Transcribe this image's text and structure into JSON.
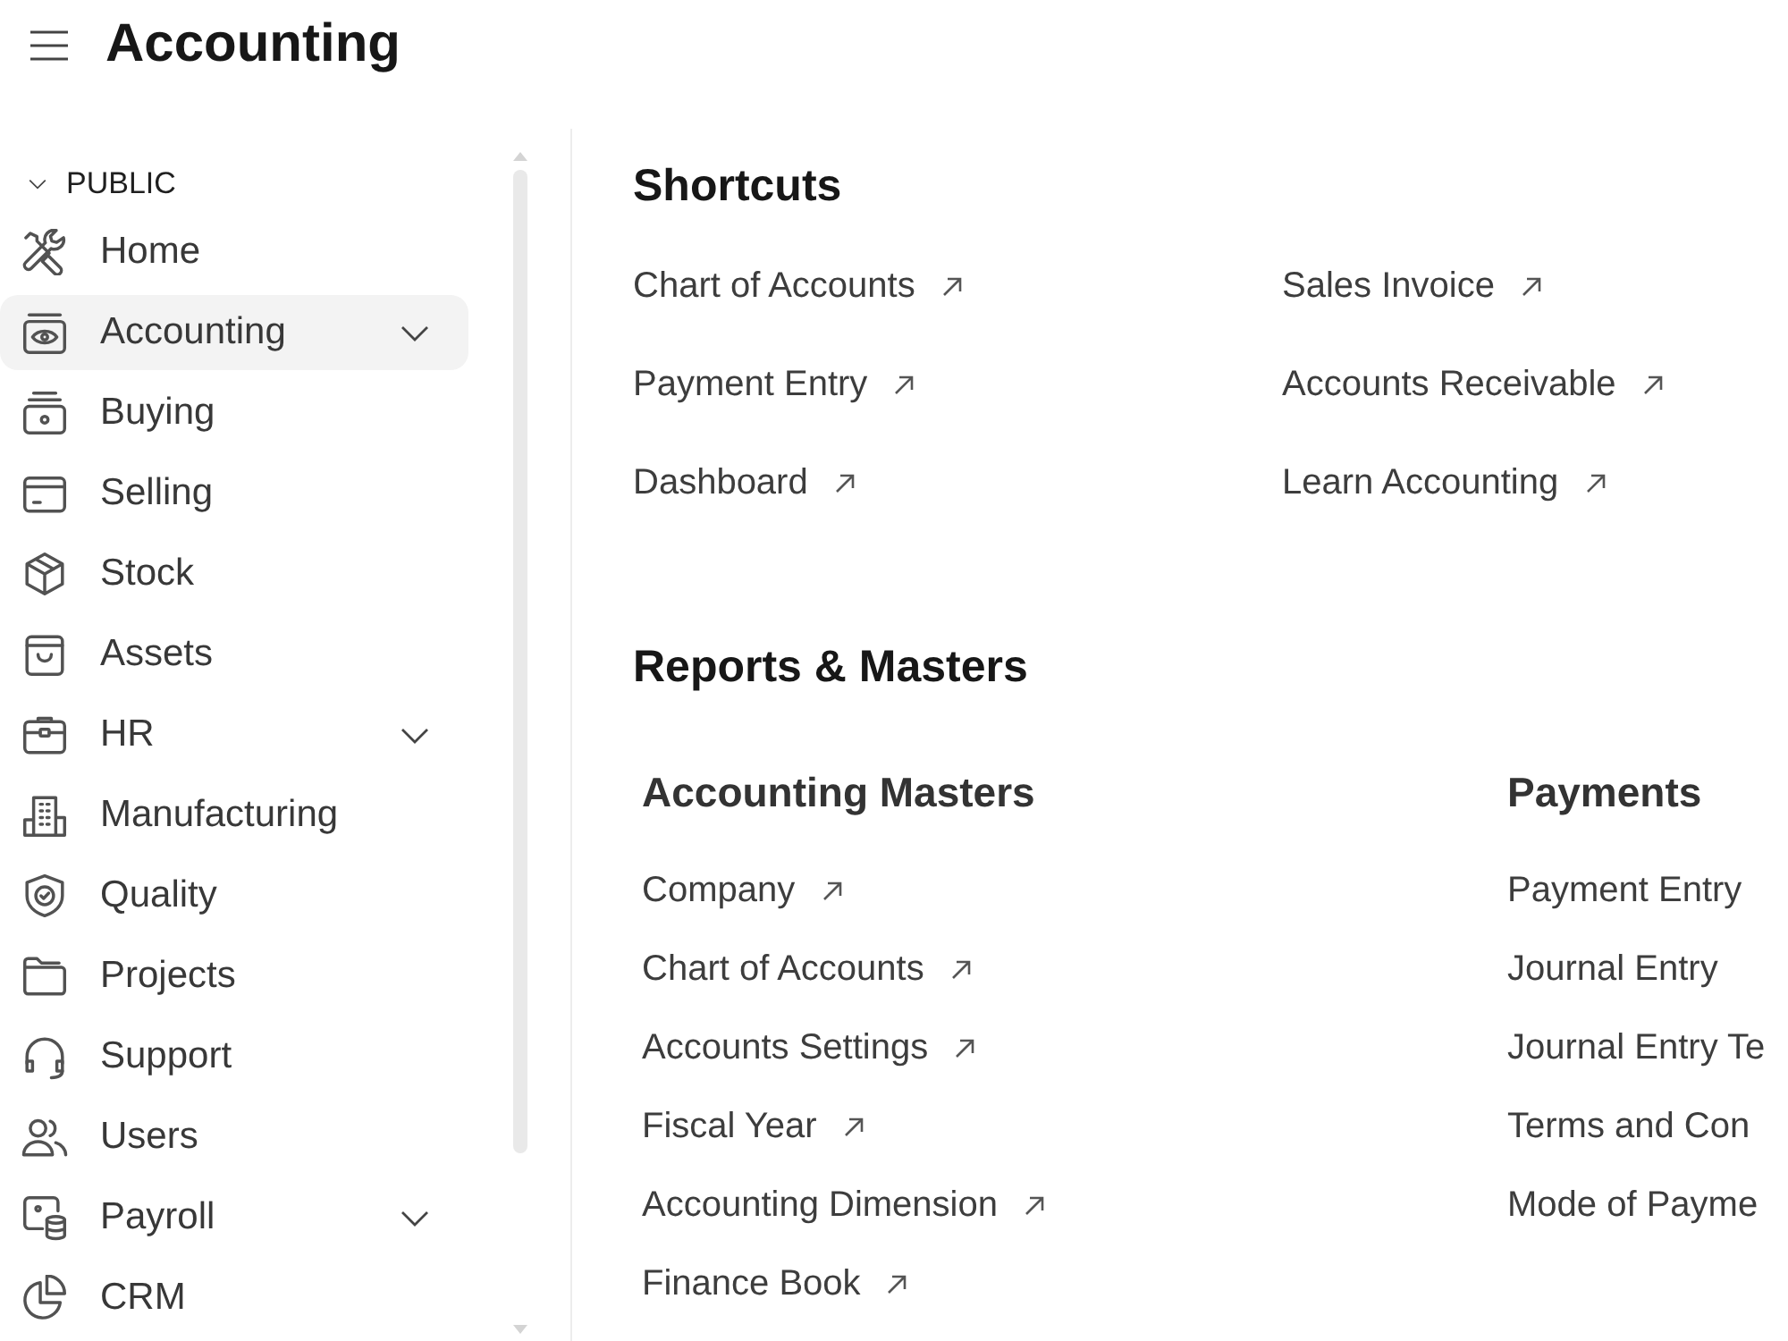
{
  "header": {
    "title": "Accounting"
  },
  "sidebar": {
    "section": {
      "label": "PUBLIC",
      "expanded": true
    },
    "items": [
      {
        "label": "Home",
        "selected": false,
        "has_submenu": false
      },
      {
        "label": "Accounting",
        "selected": true,
        "has_submenu": true
      },
      {
        "label": "Buying",
        "selected": false,
        "has_submenu": false
      },
      {
        "label": "Selling",
        "selected": false,
        "has_submenu": false
      },
      {
        "label": "Stock",
        "selected": false,
        "has_submenu": false
      },
      {
        "label": "Assets",
        "selected": false,
        "has_submenu": false
      },
      {
        "label": "HR",
        "selected": false,
        "has_submenu": true
      },
      {
        "label": "Manufacturing",
        "selected": false,
        "has_submenu": false
      },
      {
        "label": "Quality",
        "selected": false,
        "has_submenu": false
      },
      {
        "label": "Projects",
        "selected": false,
        "has_submenu": false
      },
      {
        "label": "Support",
        "selected": false,
        "has_submenu": false
      },
      {
        "label": "Users",
        "selected": false,
        "has_submenu": false
      },
      {
        "label": "Payroll",
        "selected": false,
        "has_submenu": true
      },
      {
        "label": "CRM",
        "selected": false,
        "has_submenu": false
      }
    ]
  },
  "shortcuts": {
    "title": "Shortcuts",
    "items": [
      {
        "label": "Chart of Accounts",
        "arrow": true
      },
      {
        "label": "Sales Invoice",
        "arrow": true
      },
      {
        "label": "Payment Entry",
        "arrow": true
      },
      {
        "label": "Accounts Receivable",
        "arrow": true
      },
      {
        "label": "Dashboard",
        "arrow": true
      },
      {
        "label": "Learn Accounting",
        "arrow": true
      }
    ]
  },
  "reports": {
    "title": "Reports & Masters",
    "cards": [
      {
        "title": "Accounting Masters",
        "links": [
          {
            "label": "Company",
            "arrow": true
          },
          {
            "label": "Chart of Accounts",
            "arrow": true
          },
          {
            "label": "Accounts Settings",
            "arrow": true
          },
          {
            "label": "Fiscal Year",
            "arrow": true
          },
          {
            "label": "Accounting Dimension",
            "arrow": true
          },
          {
            "label": "Finance Book",
            "arrow": true
          }
        ]
      },
      {
        "title": "Payments",
        "links": [
          {
            "label": "Payment Entry",
            "arrow": false
          },
          {
            "label": "Journal Entry",
            "arrow": false
          },
          {
            "label": "Journal Entry Te",
            "arrow": false
          },
          {
            "label": "Terms and Con",
            "arrow": false
          },
          {
            "label": "Mode of Payme",
            "arrow": false
          }
        ]
      }
    ]
  }
}
